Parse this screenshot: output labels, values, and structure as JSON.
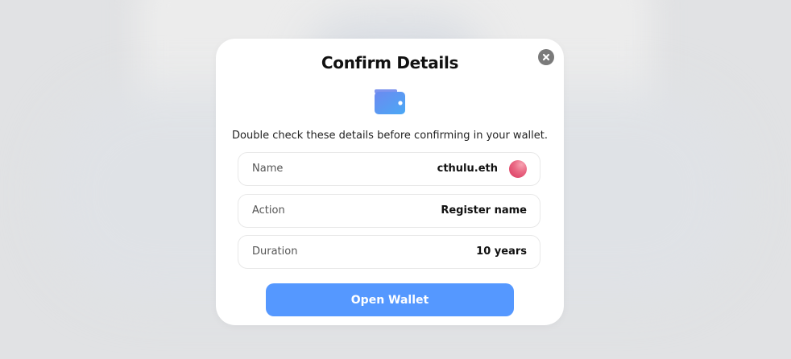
{
  "modal": {
    "title": "Confirm Details",
    "subtitle": "Double check these details before confirming in your wallet.",
    "icons": {
      "close": "close-icon",
      "wallet": "wallet-icon"
    },
    "details": [
      {
        "label": "Name",
        "value": "cthulu.eth"
      },
      {
        "label": "Action",
        "value": "Register name"
      },
      {
        "label": "Duration",
        "value": "10 years"
      }
    ],
    "primary_button_label": "Open Wallet"
  },
  "colors": {
    "accent": "#5598ff",
    "wallet_icon": "#5b8def",
    "avatar": "#e8506f",
    "close_button": "#7a7a7a"
  }
}
